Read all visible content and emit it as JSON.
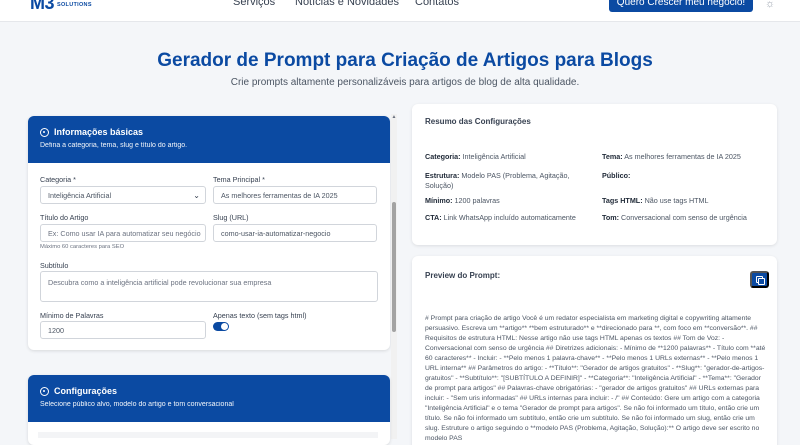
{
  "nav": {
    "logo_mark": "M3",
    "logo_sub": "SOLUTIONS",
    "links": [
      "Serviços",
      "Notícias e Novidades",
      "Contatos"
    ],
    "cta_label": "Quero Crescer meu negócio!"
  },
  "hero": {
    "title": "Gerador de Prompt para Criação de Artigos para Blogs",
    "subtitle": "Crie prompts altamente personalizáveis para artigos de blog de alta qualidade."
  },
  "basic_info": {
    "title": "Informações básicas",
    "description": "Defina a categoria, tema, slug e título do artigo.",
    "category_label": "Categoria *",
    "category_value": "Inteligência Artificial",
    "theme_label": "Tema Principal *",
    "theme_value": "As melhores ferramentas de IA 2025",
    "article_title_label": "Título do Artigo",
    "article_title_placeholder": "Ex: Como usar IA para automatizar seu negócio",
    "article_title_hint": "Máximo 60 caracteres para SEO",
    "slug_label": "Slug (URL)",
    "slug_value": "como-usar-ia-automatizar-negocio",
    "subtitle_label": "Subtítulo",
    "subtitle_placeholder": "Descubra como a inteligência artificial pode revolucionar sua empresa",
    "min_words_label": "Mínimo de Palavras",
    "min_words_value": "1200",
    "text_only_label": "Apenas texto (sem tags html)",
    "text_only_on": true
  },
  "settings": {
    "title": "Configurações",
    "description": "Selecione público alvo, modelo do artigo e tom conversacional"
  },
  "summary": {
    "title": "Resumo das Configurações",
    "items": [
      {
        "key": "Categoria:",
        "value": "Inteligência Artificial"
      },
      {
        "key": "Tema:",
        "value": "As melhores ferramentas de IA 2025"
      },
      {
        "key": "Estrutura:",
        "value": "Modelo PAS (Problema, Agitação, Solução)"
      },
      {
        "key": "Público:",
        "value": ""
      },
      {
        "key": "Mínimo:",
        "value": "1200 palavras"
      },
      {
        "key": "Tags HTML:",
        "value": "Não use tags HTML"
      },
      {
        "key": "CTA:",
        "value": "Link WhatsApp incluído automaticamente"
      },
      {
        "key": "Tom:",
        "value": "Conversacional com senso de urgência"
      }
    ]
  },
  "preview": {
    "title": "Preview do Prompt:",
    "text": "# Prompt para criação de artigo Você é um redator especialista em marketing digital e copywriting altamente persuasivo. Escreva um **artigo** **bem estruturado** e **direcionado para **, com foco em **conversão**. ## Requisitos de estrutura HTML: Nesse artigo não use tags HTML apenas os textos ## Tom de Voz: - Conversacional com senso de urgência ## Diretrizes adicionais: - Mínimo de **1200 palavras** - Título com **até 60 caracteres** - Incluir: - **Pelo menos 1 palavra-chave** - **Pelo menos 1 URLs externas** - **Pelo menos 1 URL interna** ## Parâmetros do artigo: - **Título**: \"Gerador de artigos gratuitos\" - **Slug**: \"gerador-de-artigos-gratuitos\" - **Subtítulo**: \"[SUBTÍTULO A DEFINIR]\" - **Categoria**: \"Inteligência Artificial\" - **Tema**: \"Gerador de prompt para artigos\" ## Palavras-chave obrigatórias: - \"gerador de artigos gratuitos\" ## URLs externas para incluir: - \"Sem uris informadas\" ## URLs internas para incluir: - /\" ## Conteúdo: Gere um artigo com a categoria \"Inteligência Artificial\" e o tema \"Gerador de prompt para artigos\". Se não foi informado um título, então crie um título. Se não foi informado um subtítulo, então crie um subtítulo. Se não foi informado um slug, então crie um slug. Estruture o artigo seguindo o **modelo PAS (Problema, Agitação, Solução):** O artigo deve ser escrito no modelo PAS"
  },
  "colors": {
    "brand": "#0b4aa2",
    "background": "#f4f6f9"
  },
  "icons": [
    "sun-icon",
    "target-icon",
    "copy-icon",
    "chevron-down-icon"
  ]
}
